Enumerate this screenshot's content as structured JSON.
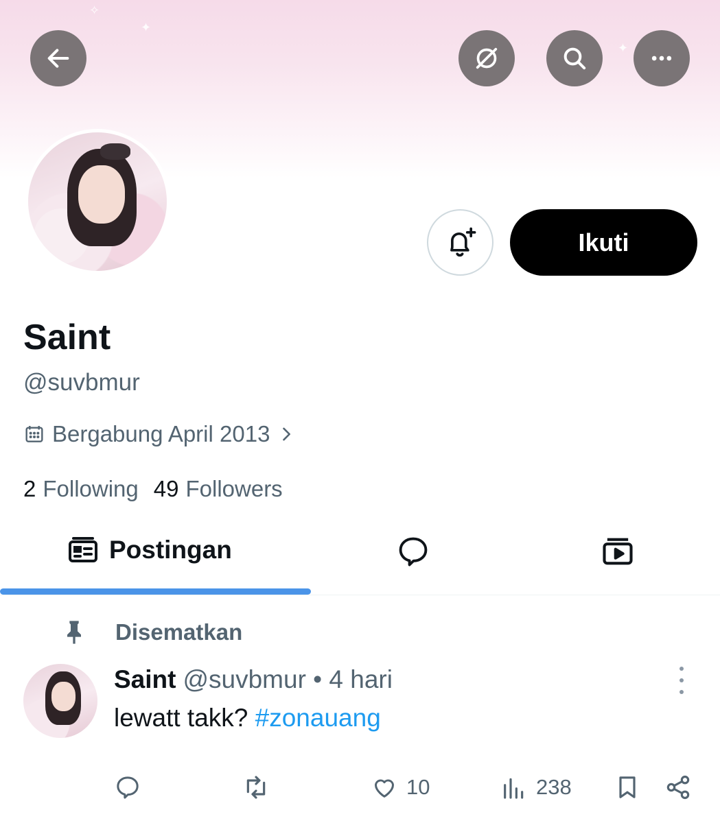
{
  "header": {
    "back_icon": "arrow-left-icon",
    "actions": [
      "grok-icon",
      "search-icon",
      "more-horizontal-icon"
    ]
  },
  "profile": {
    "name": "Saint",
    "handle": "@suvbmur",
    "joined": "Bergabung April 2013",
    "following_count": "2",
    "following_label": "Following",
    "followers_count": "49",
    "followers_label": "Followers",
    "follow_button": "Ikuti"
  },
  "tabs": [
    {
      "label": "Postingan",
      "icon": "posts-icon",
      "active": true
    },
    {
      "label": "",
      "icon": "reply-bubble-icon",
      "active": false
    },
    {
      "label": "",
      "icon": "media-icon",
      "active": false
    }
  ],
  "post": {
    "pinned_label": "Disematkan",
    "author_name": "Saint",
    "author_meta": "@suvbmur • 4 hari",
    "text": "lewatt takk?",
    "hashtag": "#zonauang",
    "likes": "10",
    "views": "238"
  },
  "colors": {
    "accent": "#1d9bf0",
    "tab_indicator": "#4b94e8",
    "muted_text": "#536471",
    "header_button": "#7a7476"
  }
}
